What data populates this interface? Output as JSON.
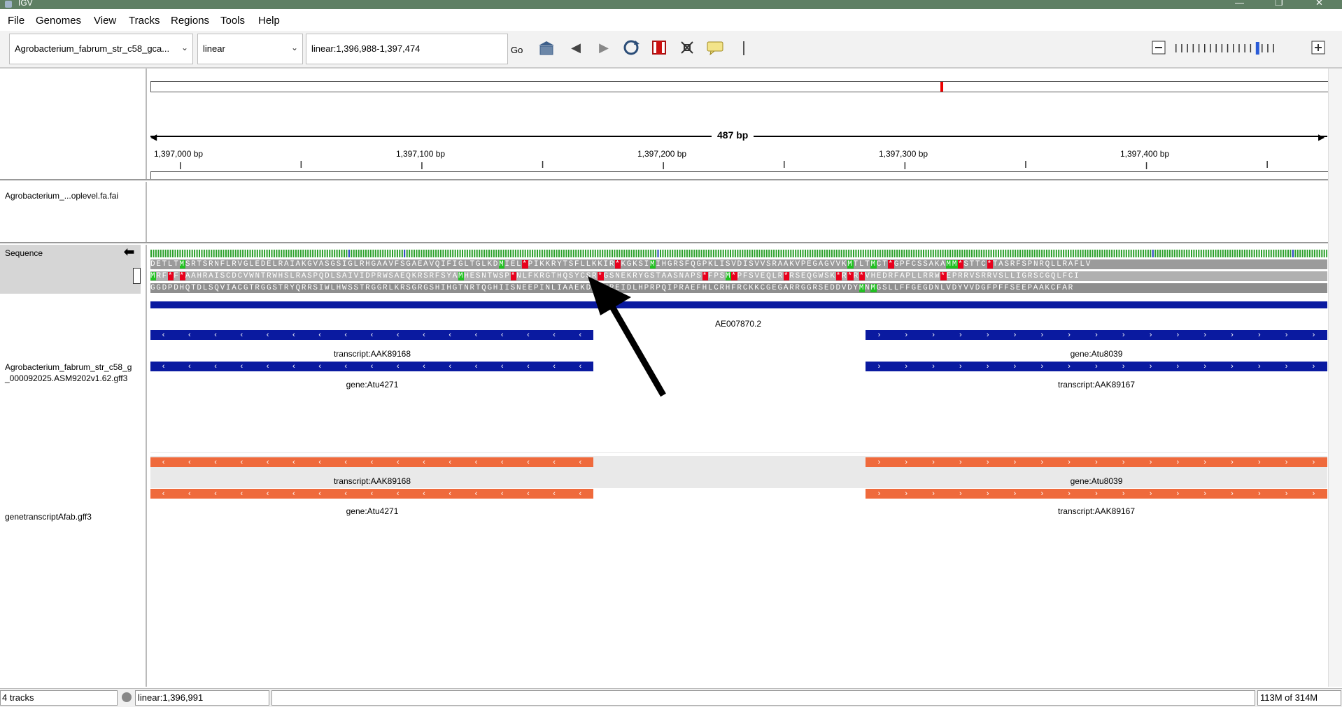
{
  "window": {
    "title": "IGV"
  },
  "menu": [
    "File",
    "Genomes",
    "View",
    "Tracks",
    "Regions",
    "Tools",
    "Help"
  ],
  "toolbar": {
    "genome": "Agrobacterium_fabrum_str_c58_gca...",
    "chromosome": "linear",
    "locus": "linear:1,396,988-1,397,474",
    "go_label": "Go"
  },
  "ruler": {
    "span": "487 bp",
    "ticks": [
      "1,397,000 bp",
      "1,397,100 bp",
      "1,397,200 bp",
      "1,397,300 bp",
      "1,397,400 bp"
    ]
  },
  "tracks": {
    "fai_name": "Agrobacterium_...oplevel.fa.fai",
    "sequence_name": "Sequence",
    "gff1_name": "Agrobacterium_fabrum_str_c58_g\n_000092025.ASM9202v1.62.gff3",
    "gff2_name": "genetranscriptAfab.gff3",
    "contig_label": "AE007870.2",
    "features": {
      "left_top": "transcript:AAK89168",
      "left_bottom": "gene:Atu4271",
      "right_top": "gene:Atu8039",
      "right_bottom": "transcript:AAK89167"
    },
    "seq_frames": [
      "DETLTMSRTSRNFLRVGLEDELRAIAKGVASGSIGLRHGAAVFSGAEAVQIFIGLTGLKDMIEL*PIKKRYTSFLLKKIR*KGKSIMIHGRSFQGPKLISVDISVVSRAAKVPEGAGVVKMTLTMCT*GPFCSSAKAMM*STTC*TASRFSPNRQLLRAFLV",
      "MRF*F*AAHRAISCDCVWNTRWHSLRASPQDLSAIVIDPRWSAEQKRSRFSYAMHESNTWSP*NLFKRGTHQSYCSR*GSNEKRYGSTAASNAPS*FPSM*PFSVEQLR*RSEQGWSK*R*R*VHEDRFAPLLRRW*EPRRVSRRVSLLIGRSCGQLFCI",
      "GGDPDHQTDLSQVIACGTRGGSTRYQRRSIWLHWSSTRGGRLKRSGRGSHIHGTNRTQGHIISNEEPINLIAAEKDAIKREIDLHPRPQIPRAEFHLCRHFRCKKCGEGARRGGRSEDDVDYMNMGSLLFFGEGDNLVDYVVDGFPFFSEEPAAKCFAR"
    ]
  },
  "status": {
    "tracks": "4 tracks",
    "position": "linear:1,396,991",
    "memory": "113M of 314M"
  },
  "colors": {
    "blue_feature": "#0a1aa0",
    "orange_feature": "#ef6a3c",
    "stop_codon": "#e8001c",
    "start_codon": "#22c022",
    "seq_bg_dark": "#8c8c8c",
    "seq_bg_light": "#b4b4b4"
  }
}
